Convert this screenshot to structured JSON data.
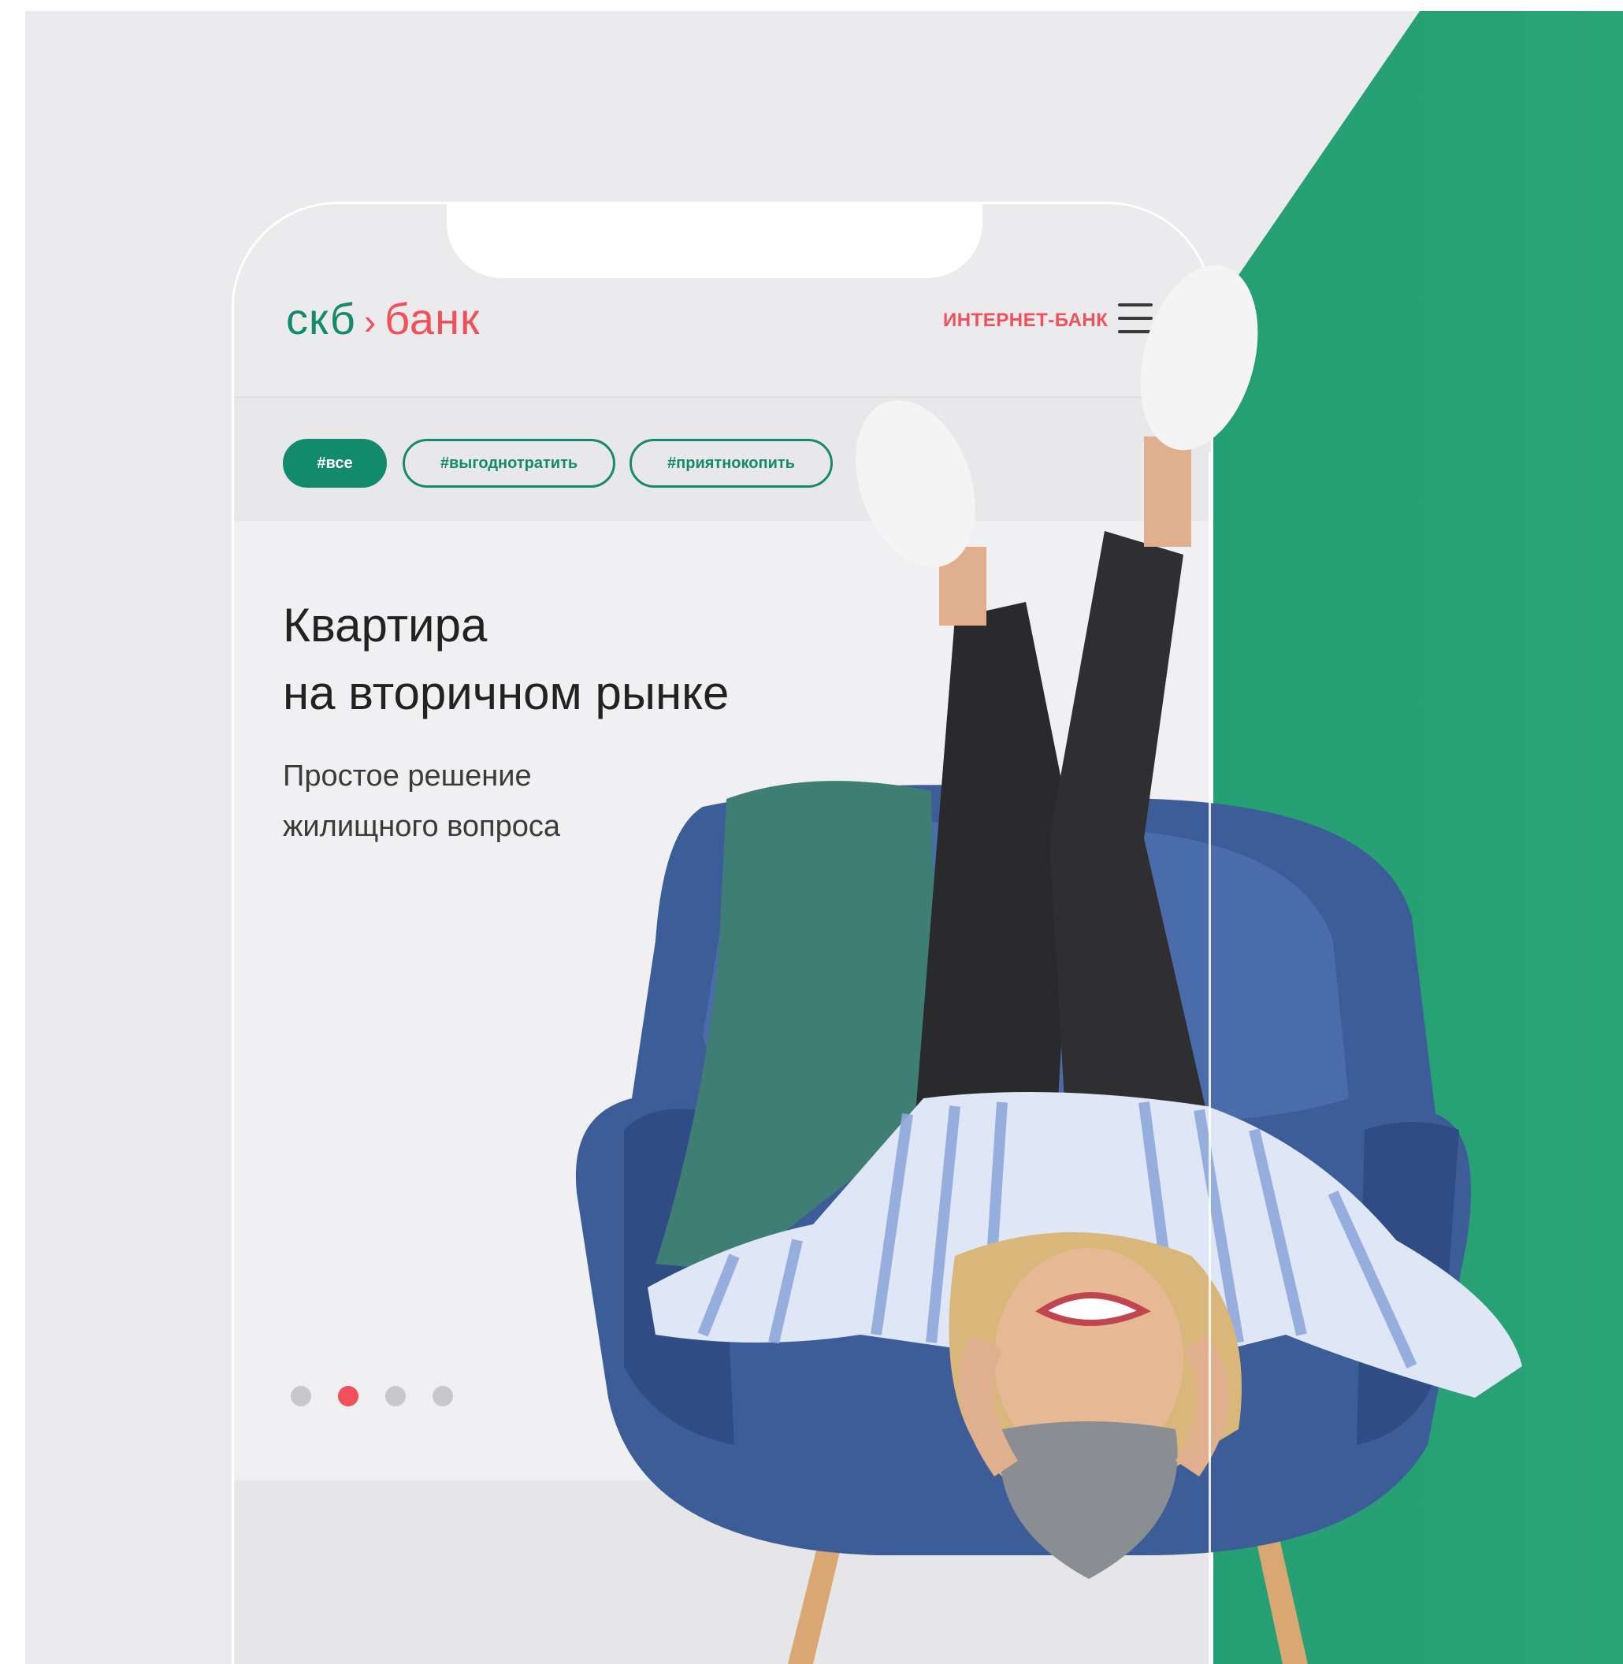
{
  "colors": {
    "brand_green": "#138a6b",
    "brand_red": "#f0505a",
    "page_bg": "#ebebed"
  },
  "header": {
    "logo_part1": "скб",
    "logo_separator": "›",
    "logo_part2": "банк",
    "internet_bank": "ИНТЕРНЕТ-БАНК",
    "menu_icon": "hamburger-menu-icon"
  },
  "tags": [
    {
      "label": "#все",
      "active": true
    },
    {
      "label": "#выгоднотратить",
      "active": false
    },
    {
      "label": "#приятнокопить",
      "active": false
    }
  ],
  "hero": {
    "title": "Квартира\nна вторичном рынке",
    "subtitle": "Простое решение\nжилищного вопроса"
  },
  "carousel": {
    "count": 4,
    "active_index": 1
  }
}
